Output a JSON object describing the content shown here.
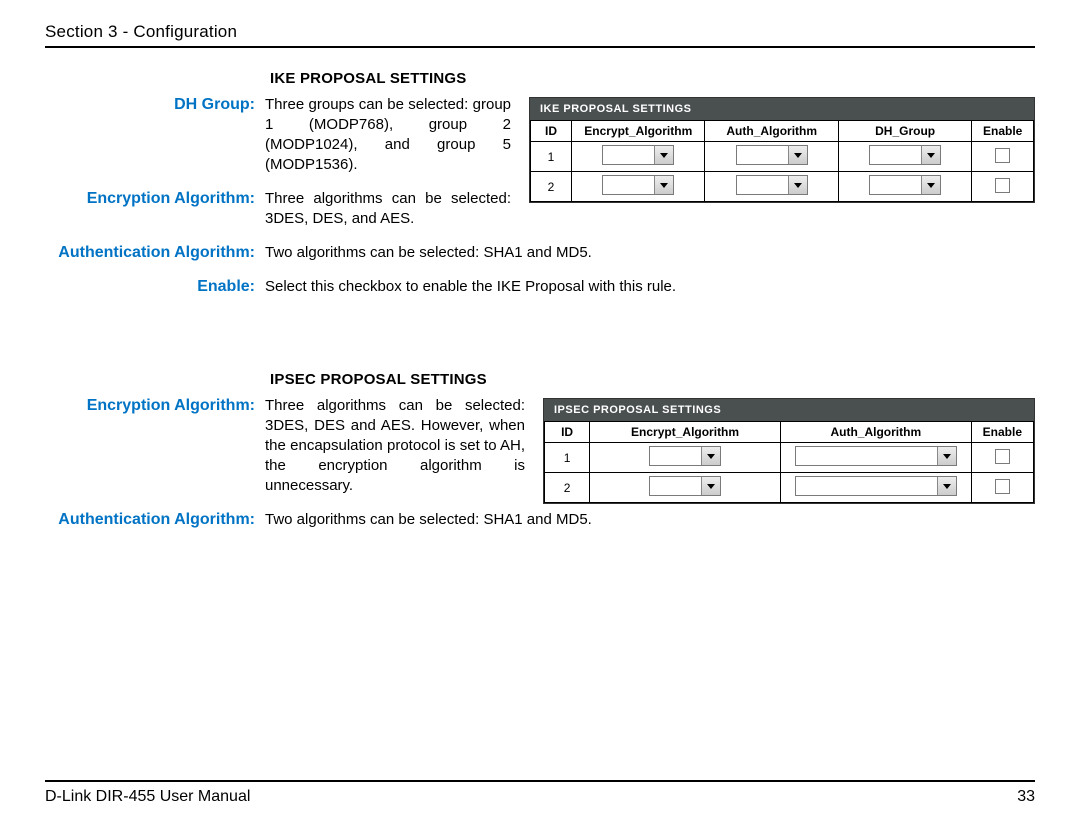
{
  "header": "Section 3 - Configuration",
  "ike": {
    "title": "IKE PROPOSAL SETTINGS",
    "items": [
      {
        "label": "DH Group:",
        "text": "Three groups can be selected: group 1 (MODP768), group 2 (MODP1024), and group 5 (MODP1536).",
        "narrow": true
      },
      {
        "label": "Encryption Algorithm:",
        "text": "Three algorithms can be selected: 3DES, DES, and AES.",
        "narrow": true
      },
      {
        "label": "Authentication Algorithm:",
        "text": "Two algorithms can be selected: SHA1 and MD5.",
        "narrow": false
      },
      {
        "label": "Enable:",
        "text": "Select this checkbox to enable the IKE Proposal with this rule.",
        "narrow": false
      }
    ],
    "panel": {
      "bar": "IKE PROPOSAL SETTINGS",
      "headers": [
        "ID",
        "Encrypt_Algorithm",
        "Auth_Algorithm",
        "DH_Group",
        "Enable"
      ],
      "rows": [
        "1",
        "2"
      ]
    }
  },
  "ipsec": {
    "title": "IPSEC PROPOSAL SETTINGS",
    "items": [
      {
        "label": "Encryption Algorithm:",
        "text": "Three algorithms can be selected: 3DES, DES and AES. However, when the encapsulation protocol is set to AH, the encryption algorithm is unnecessary.",
        "narrow": true
      },
      {
        "label": "Authentication Algorithm:",
        "text": "Two algorithms can be selected: SHA1 and MD5.",
        "narrow": false
      }
    ],
    "panel": {
      "bar": "IPSEC PROPOSAL SETTINGS",
      "headers": [
        "ID",
        "Encrypt_Algorithm",
        "Auth_Algorithm",
        "Enable"
      ],
      "rows": [
        "1",
        "2"
      ]
    }
  },
  "footer": {
    "left": "D-Link DIR-455 User Manual",
    "right": "33"
  }
}
